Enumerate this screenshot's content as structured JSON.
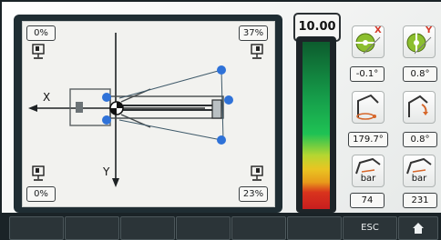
{
  "diagram": {
    "top_left_pct": "0%",
    "top_right_pct": "37%",
    "bottom_left_pct": "0%",
    "bottom_right_pct": "23%",
    "x_axis_label": "X",
    "y_axis_label": "Y"
  },
  "main_value": "10.00",
  "level_bar_colors": [
    "#0d5c2e",
    "#1fc254",
    "#e9c522",
    "#e89a1b",
    "#c81e1e"
  ],
  "tiles": {
    "tilt_x": {
      "axis": "X",
      "value": "-0.1°",
      "icon": "tilt-x-level-icon"
    },
    "tilt_y": {
      "axis": "Y",
      "value": "0.8°",
      "icon": "tilt-y-level-icon"
    },
    "slew": {
      "value": "179.7°",
      "icon": "slew-angle-icon"
    },
    "boom_angle": {
      "value": "0.8°",
      "icon": "boom-angle-icon"
    },
    "pressure_1": {
      "unit": "bar",
      "value": "74",
      "icon": "crane-pressure-icon"
    },
    "pressure_2": {
      "unit": "bar",
      "value": "231",
      "icon": "crane-pressure-icon"
    }
  },
  "softkeys": [
    "",
    "",
    "",
    "",
    "",
    "",
    "ESC",
    "home"
  ]
}
